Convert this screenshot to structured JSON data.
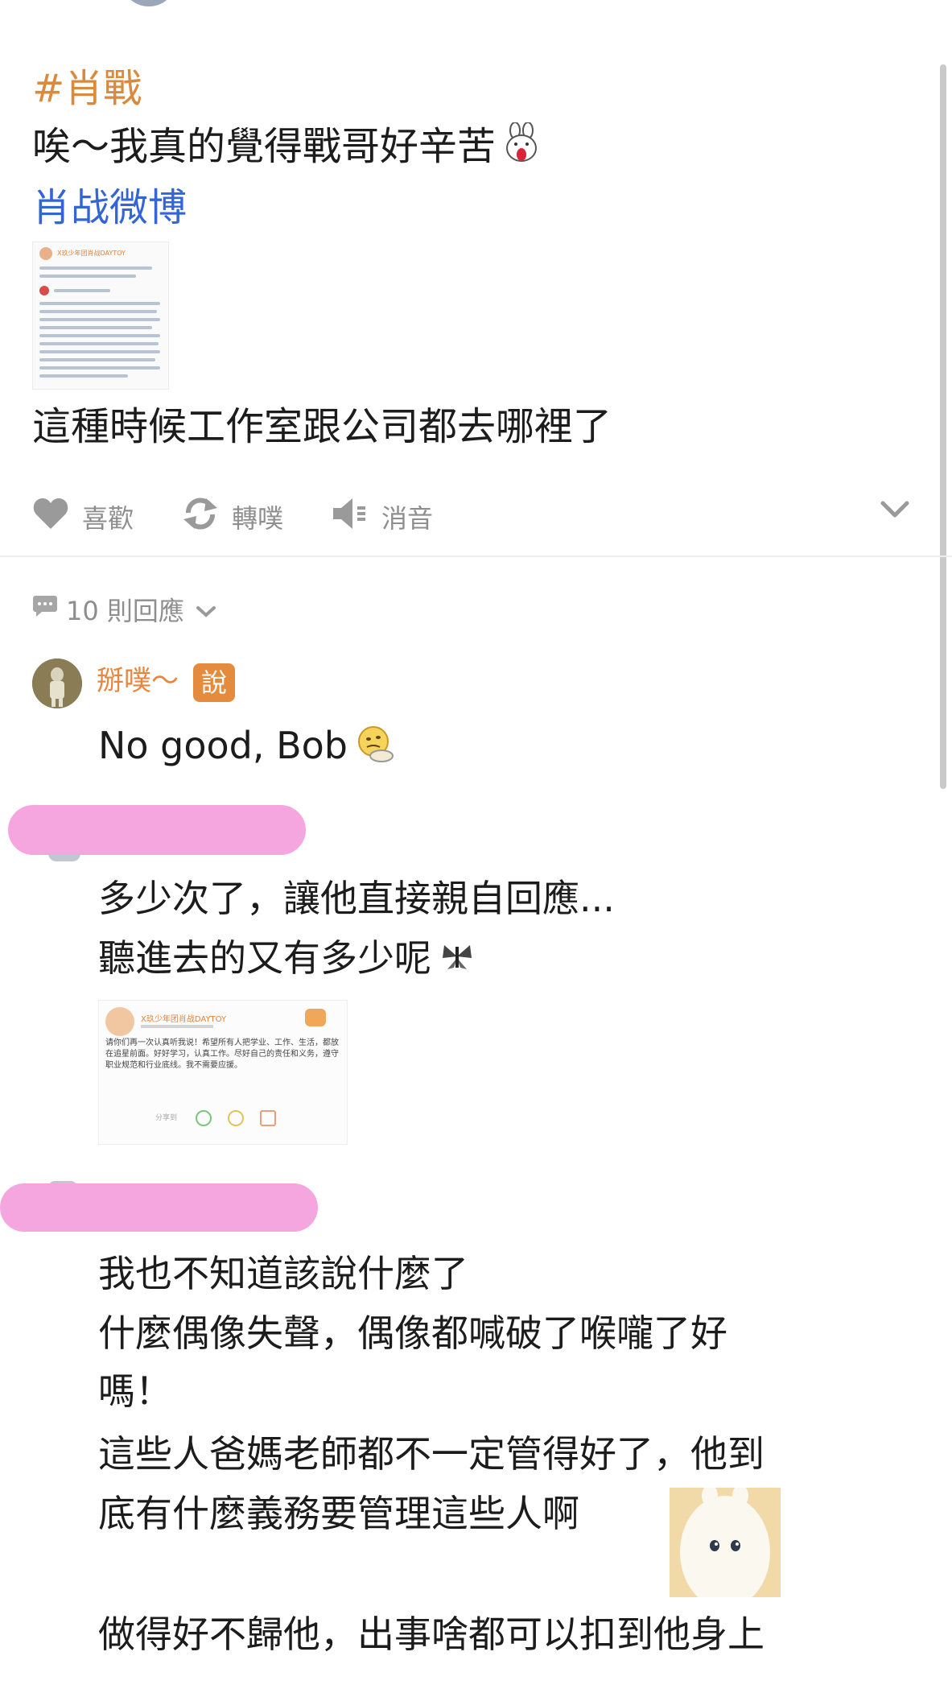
{
  "post": {
    "hashtag": "#肖戰",
    "line1": "唉～我真的覺得戰哥好辛苦",
    "link": "肖战微博",
    "line2": "這種時候工作室跟公司都去哪裡了",
    "thumbnail_title": "X玖少年团肖战DAYTOY"
  },
  "actions": {
    "like": "喜歡",
    "repost": "轉噗",
    "mute": "消音"
  },
  "replies": {
    "count_label": "10 則回應"
  },
  "comments": [
    {
      "name": "掰噗～",
      "badge": "說",
      "text": "No good, Bob"
    },
    {
      "lines": [
        "多少次了，讓他直接親自回應...",
        "聽進去的又有多少呢"
      ],
      "quote": {
        "name": "X玖少年团肖战DAYTOY",
        "body": "请你们再一次认真听我说！希望所有人把学业、工作、生活，都放在追星前面。好好学习，认真工作。尽好自己的责任和义务，遵守职业规范和行业底线。我不需要应援。",
        "footer": "分享到"
      }
    },
    {
      "lines": [
        "我也不知道該說什麼了",
        "什麼偶像失聲，偶像都喊破了喉嚨了好",
        "嗎！",
        "這些人爸媽老師都不一定管得好了，他到",
        "底有什麼義務要管理這些人啊",
        "做得好不歸他，出事啥都可以扣到他身上"
      ]
    }
  ],
  "colors": {
    "hashtag": "#d98a3c",
    "link": "#3465d6",
    "username": "#e8853e",
    "action_gray": "#8e8e8e",
    "redaction": "#f6a6de"
  }
}
